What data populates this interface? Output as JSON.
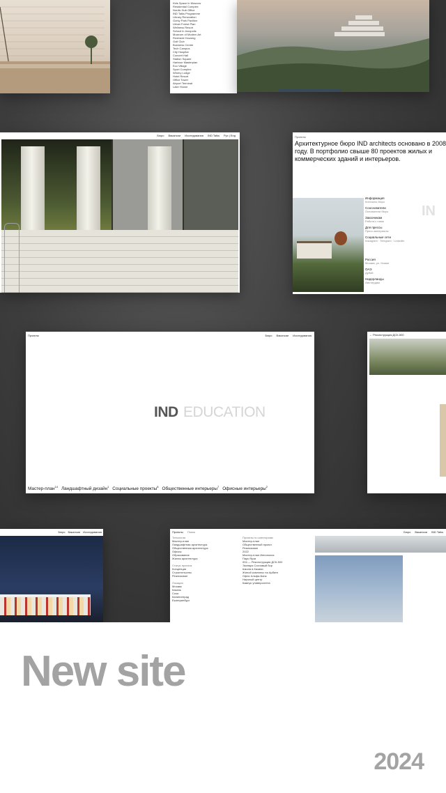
{
  "headline": "New site",
  "year": "2024",
  "cols_card": {
    "nav": [
      "Бюро",
      "Вакансии",
      "Исследования",
      "IND Talks"
    ],
    "lang": "Рус | Eng"
  },
  "about_card": {
    "breadcrumb": "Проекты",
    "text": "Архитектурное бюро IND architects основано в 2008 году. В портфолио свыше 80 проектов жилых и коммерческих зданий и интерьеров.",
    "info": [
      {
        "label": "Информация",
        "value": "Контакты бюро"
      },
      {
        "label": "Сооснователи",
        "value": "Основатели бюро"
      },
      {
        "label": "Заказчикам",
        "value": "Работа с нами"
      },
      {
        "label": "Для прессы",
        "value": "Пресс-материалы"
      },
      {
        "label": "Социальные сети",
        "value": "Instagram · Telegram · LinkedIn"
      }
    ],
    "offices": [
      {
        "label": "Россия",
        "value": "Москва, ул. Новая"
      },
      {
        "label": "ОАЭ",
        "value": "Дубай"
      },
      {
        "label": "Нидерланды",
        "value": "Амстердам"
      }
    ]
  },
  "edu_card": {
    "nav_left": "Проекты",
    "nav_right": [
      "Бюро",
      "Вакансии",
      "Исследования"
    ],
    "logo": "IND",
    "word": "EDUCATION",
    "categories": [
      {
        "name": "Мастер-план",
        "count": "14"
      },
      {
        "name": "Ландшафтный дизайн",
        "count": "1"
      },
      {
        "name": "Социальные проекты",
        "count": "8"
      },
      {
        "name": "Общественные интерьеры",
        "count": "7"
      },
      {
        "name": "Офисные интерьеры",
        "count": "2"
      }
    ]
  },
  "edu2_card": {
    "breadcrumb": "Реконструкция ДСК-500"
  },
  "night_card": {
    "nav": [
      "Бюро",
      "Вакансии",
      "Исследования"
    ]
  },
  "proj_card": {
    "tabs": [
      "Проекты",
      "Поиск"
    ],
    "nav": [
      "Бюро",
      "Вакансии",
      "IND Talks"
    ],
    "filter_groups": [
      {
        "title": "Типология",
        "items": [
          "Мастер-план",
          "Ландшафтная архитектура",
          "Общественная архитектура",
          "Офисы",
          "Образование",
          "Жилая архитектура"
        ]
      },
      {
        "title": "Статус проекта",
        "items": [
          "Концепция",
          "Строительство",
          "Реализован"
        ]
      },
      {
        "title": "Локация",
        "items": [
          "Москва",
          "Казань",
          "Сочи",
          "Калининград",
          "Екатеринбург"
        ]
      }
    ],
    "results_title": "Проекты по категориям",
    "results": [
      "Мастер-план",
      "Общественный проект",
      "Реализован",
      "2022",
      "Мастер-план Иннополис",
      "Парк Яуза",
      "004 — Реконструкция ДСК-500",
      "Экопарк Сосновый бор",
      "Школа в Казани",
      "Жилой комплекс на Арбате",
      "Офис Альфа-Банк",
      "Научный центр",
      "Кампус университета"
    ]
  },
  "list_card": {
    "lines": [
      "Kids Space in Moscow",
      "Residential Complex",
      "Nordic Hub Office",
      "IND Talks Programme",
      "Library Renovation",
      "Gorky Park Pavilion",
      "Urban Forest Plan",
      "Wellness Resort",
      "School in Innopolis",
      "Museum of Modern Art",
      "Riverside Housing",
      "Golf Club",
      "Business Centre",
      "Tech Campus",
      "City Hospital",
      "Concert Hall",
      "Station Square",
      "Harbour Masterplan",
      "Eco Village",
      "Sport Complex",
      "Winery Lodge",
      "Hotel Resort",
      "Office Tower",
      "Airport Terminal",
      "Lake House"
    ]
  },
  "colors": {
    "stage": "#3d3d3d",
    "headline": "#a3a3a3",
    "accent_text": "#222222"
  }
}
